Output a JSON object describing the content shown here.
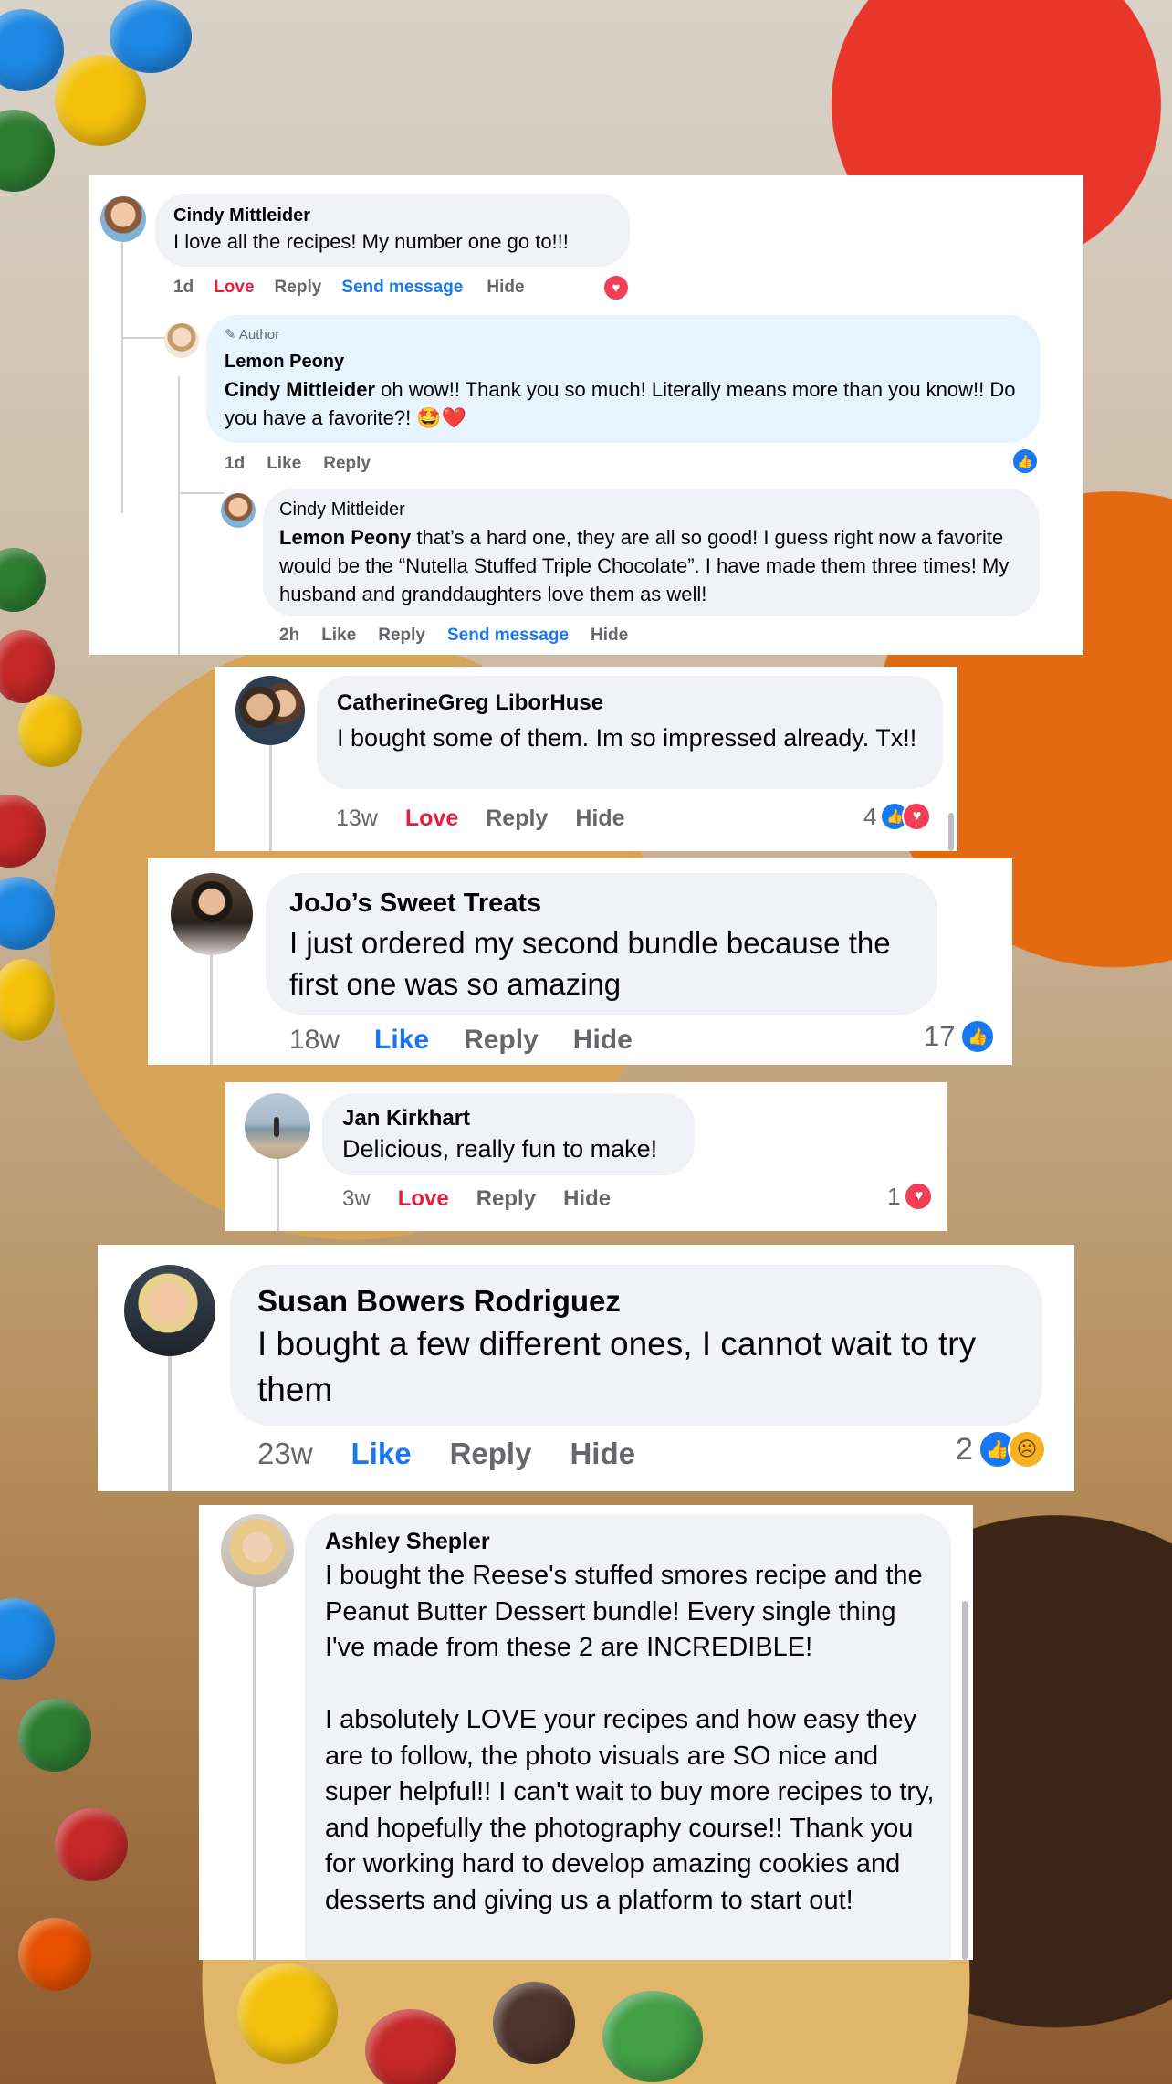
{
  "colors": {
    "love": "#e41e3f",
    "like": "#1877f2",
    "bubble": "#f0f2f5",
    "author_bubble": "#e7f3ff",
    "meta": "#65676b"
  },
  "comment1": {
    "name": "Cindy Mittleider",
    "text": "I love all the recipes! My number one go to!!!",
    "time": "1d",
    "love": "Love",
    "reply": "Reply",
    "send": "Send message",
    "hide": "Hide",
    "reaction_icon": "heart-icon",
    "reply_author": {
      "badge": "Author",
      "name": "Lemon Peony",
      "mention": "Cindy Mittleider",
      "text": " oh wow!! Thank you so much! Literally means more than you know!! Do you have a favorite?! 🤩❤️",
      "time": "1d",
      "like": "Like",
      "reply": "Reply",
      "reaction_icon": "like-icon"
    },
    "reply_cindy": {
      "name": "Cindy Mittleider",
      "mention": "Lemon Peony",
      "text": " that’s a hard one, they are all so good! I guess right now a favorite would be the “Nutella Stuffed Triple Chocolate”. I have made them three times! My husband and granddaughters love them as well!",
      "time": "2h",
      "like": "Like",
      "reply": "Reply",
      "send": "Send message",
      "hide": "Hide"
    }
  },
  "comment2": {
    "name": "CatherineGreg LiborHuse",
    "text": "I bought some of them. Im so impressed already. Tx!!",
    "time": "13w",
    "love": "Love",
    "reply": "Reply",
    "hide": "Hide",
    "count": "4"
  },
  "comment3": {
    "name": "JoJo’s Sweet Treats",
    "text": "I just ordered my second bundle because the first one was so amazing",
    "time": "18w",
    "like": "Like",
    "reply": "Reply",
    "hide": "Hide",
    "count": "17"
  },
  "comment4": {
    "name": "Jan Kirkhart",
    "text": "Delicious, really fun to make!",
    "time": "3w",
    "love": "Love",
    "reply": "Reply",
    "hide": "Hide",
    "count": "1"
  },
  "comment5": {
    "name": "Susan Bowers Rodriguez",
    "text": "I bought a few different ones, I cannot wait to try them",
    "time": "23w",
    "like": "Like",
    "reply": "Reply",
    "hide": "Hide",
    "count": "2"
  },
  "comment6": {
    "name": "Ashley Shepler",
    "text1": "I bought the Reese's stuffed smores recipe and the Peanut Butter Dessert bundle! Every single thing I've made from these 2 are INCREDIBLE!",
    "text2": "I absolutely LOVE your recipes and how easy they are to follow, the photo visuals are SO nice and super helpful!! I can't wait to buy more recipes to try, and hopefully the photography course!! Thank you for working hard to develop amazing cookies and desserts and giving us a platform to start out!"
  }
}
